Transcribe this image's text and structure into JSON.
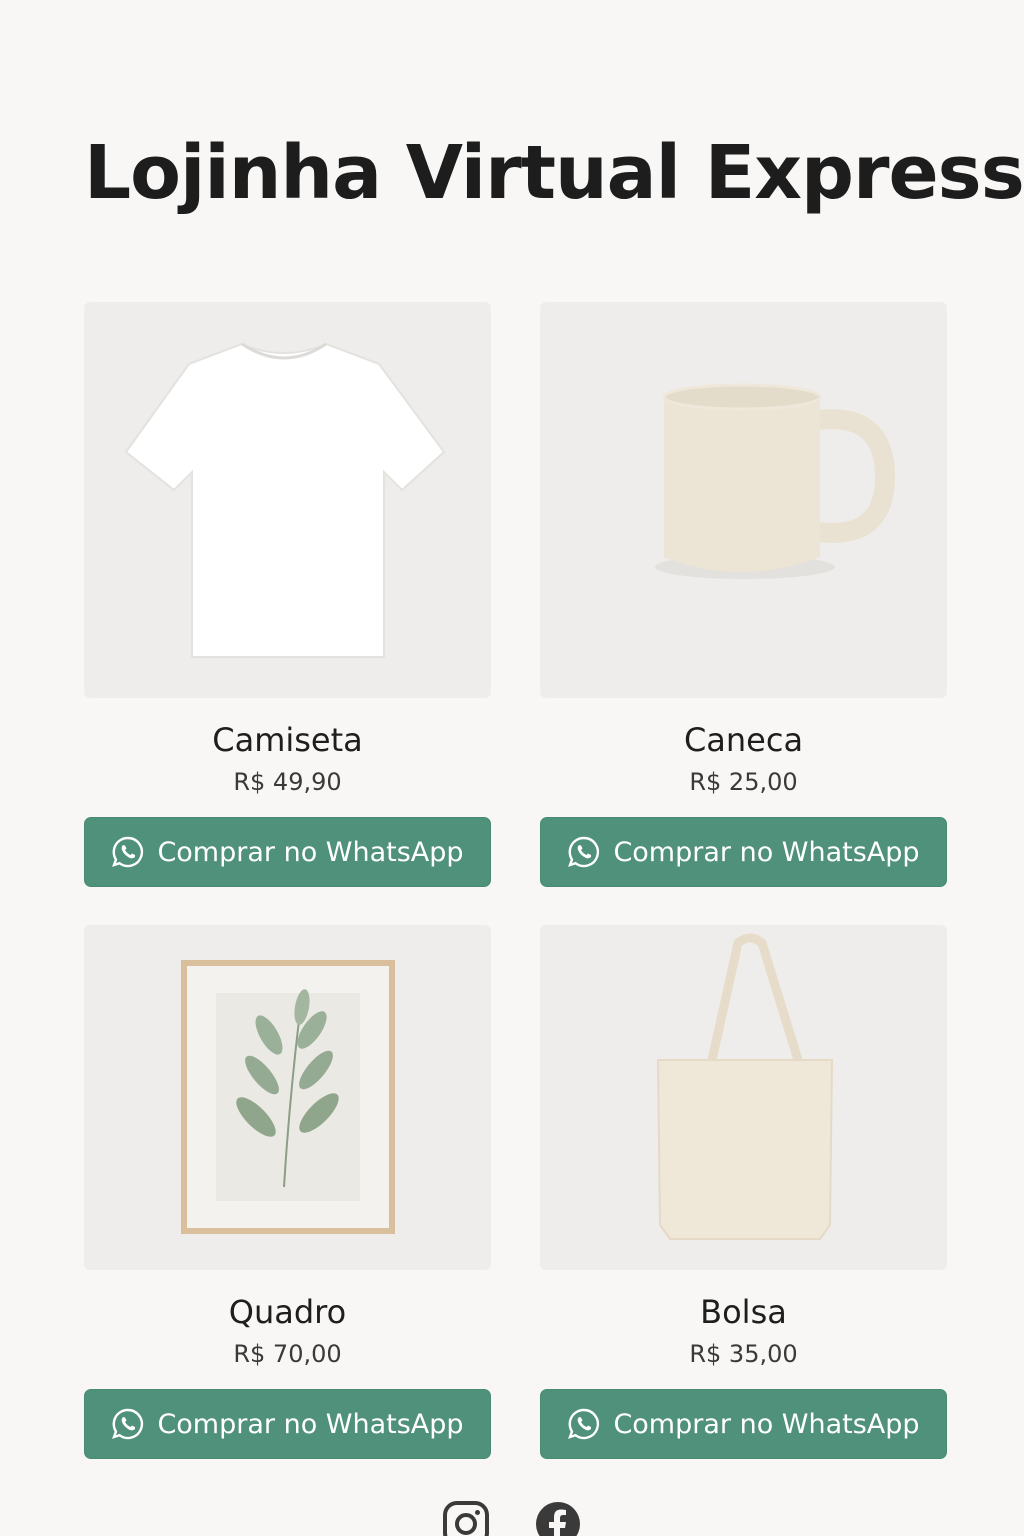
{
  "store": {
    "title": "Lojinha Virtual Express"
  },
  "products": [
    {
      "name": "Camiseta",
      "price": "R$ 49,90",
      "button_label": "Comprar no WhatsApp",
      "image": "white-tshirt"
    },
    {
      "name": "Caneca",
      "price": "R$ 25,00",
      "button_label": "Comprar no WhatsApp",
      "image": "beige-mug"
    },
    {
      "name": "Quadro",
      "price": "R$ 70,00",
      "button_label": "Comprar no WhatsApp",
      "image": "framed-leaf-print"
    },
    {
      "name": "Bolsa",
      "price": "R$ 35,00",
      "button_label": "Comprar no WhatsApp",
      "image": "canvas-tote-bag"
    }
  ],
  "social": [
    "instagram-icon",
    "facebook-icon"
  ],
  "colors": {
    "button": "#4f917a",
    "background": "#f8f7f5",
    "image_bg": "#eeedeb"
  }
}
